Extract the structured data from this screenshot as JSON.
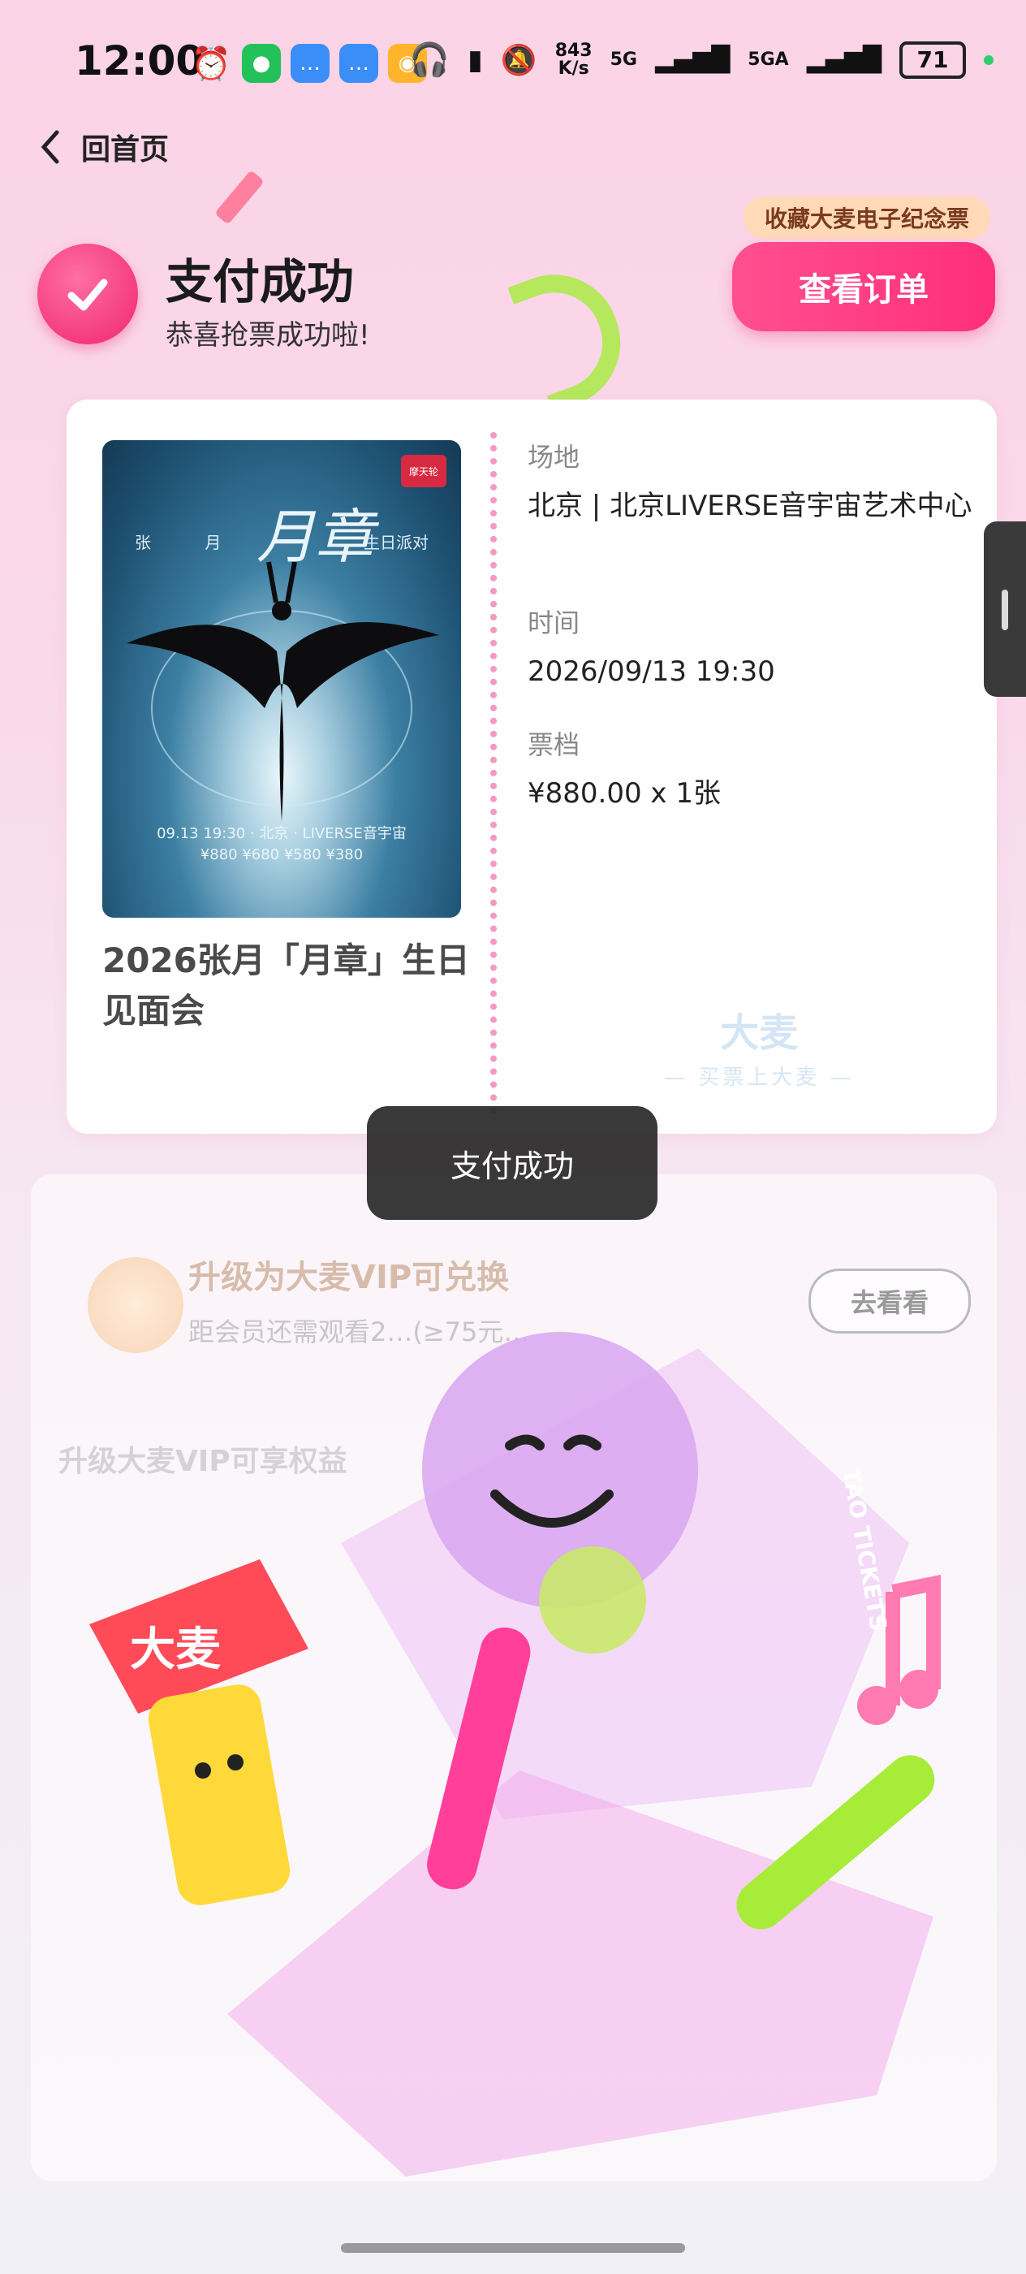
{
  "status_bar": {
    "time": "12:00",
    "net_speed_top": "843",
    "net_speed_unit": "K/s",
    "signal1": "5G",
    "signal2": "5GA",
    "battery": "71",
    "app_icons": [
      "alarm-icon",
      "wechat-icon",
      "message-icon",
      "message-icon",
      "weibo-icon"
    ],
    "right_icons": [
      "headphones-icon",
      "battery-saver-icon",
      "mute-icon"
    ]
  },
  "nav": {
    "back_label": "回首页"
  },
  "header": {
    "title": "支付成功",
    "subtitle": "恭喜抢票成功啦!",
    "collect_tag": "收藏大麦电子纪念票",
    "order_button": "查看订单"
  },
  "ticket": {
    "poster": {
      "title": "月章",
      "left_text": "张  月",
      "right_text": "生日派对",
      "date_line": "09.13  19:30  ·  北京 · LIVERSE音宇宙",
      "price_line": "¥880  ¥680  ¥580  ¥380",
      "logo": "摩天轮"
    },
    "event_name": "2026张月「月章」生日见面会",
    "venue_label": "场地",
    "venue_value": "北京 | 北京LIVERSE音宇宙艺术中心",
    "time_label": "时间",
    "time_value": "2026/09/13 19:30",
    "tier_label": "票档",
    "tier_value": "¥880.00 x 1张",
    "watermark_brand": "大麦",
    "watermark_slogan": "— 买票上大麦 —"
  },
  "vip": {
    "upgrade_text": "升级为大麦VIP可兑换",
    "progress_text": "距会员还需观看2…(≥75元…",
    "go_button": "去看看",
    "benefit_text": "升级大麦VIP可享权益"
  },
  "toast": {
    "message": "支付成功"
  },
  "colors": {
    "accent": "#ff2e7a",
    "badge": "#f0266d"
  }
}
